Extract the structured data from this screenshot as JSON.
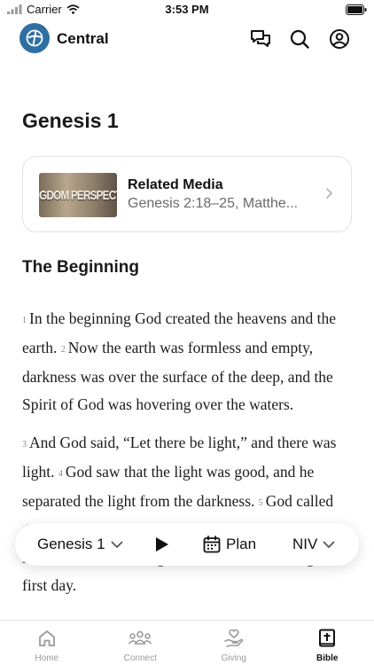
{
  "status_bar": {
    "carrier": "Carrier",
    "time": "3:53 PM"
  },
  "header": {
    "brand": "Central"
  },
  "page": {
    "title": "Genesis 1"
  },
  "related_media": {
    "thumbnail_text": "NGDOM PERSPECTI",
    "title": "Related Media",
    "subtitle": "Genesis 2:18–25, Matthe..."
  },
  "section": {
    "heading": "The Beginning"
  },
  "scripture": {
    "paragraphs": [
      [
        {
          "num": "1",
          "text": "In the beginning God created the heavens and the earth."
        },
        {
          "num": "2",
          "text": "Now the earth was formless and empty, darkness was over the surface of the deep, and the Spirit of God was hovering over the waters."
        }
      ],
      [
        {
          "num": "3",
          "text": "And God said, “Let there be light,” and there was light."
        },
        {
          "num": "4",
          "text": "God saw that the light was good, and he separated the light from the darkness."
        },
        {
          "num": "5",
          "text": "God called the light “day,” and the darkness he called “night.” And there was evening, and there was morning—the first day."
        }
      ]
    ]
  },
  "reader_toolbar": {
    "chapter": "Genesis 1",
    "plan": "Plan",
    "version": "NIV"
  },
  "tabs": [
    {
      "label": "Home",
      "icon": "home-icon",
      "active": false
    },
    {
      "label": "Connect",
      "icon": "people-icon",
      "active": false
    },
    {
      "label": "Giving",
      "icon": "giving-hand-icon",
      "active": false
    },
    {
      "label": "Bible",
      "icon": "bible-icon",
      "active": true
    }
  ],
  "colors": {
    "brand_blue": "#2f6fa3",
    "text_dark": "#111111",
    "text_muted": "#6a6a6a",
    "tab_inactive": "#9a9a9a"
  }
}
